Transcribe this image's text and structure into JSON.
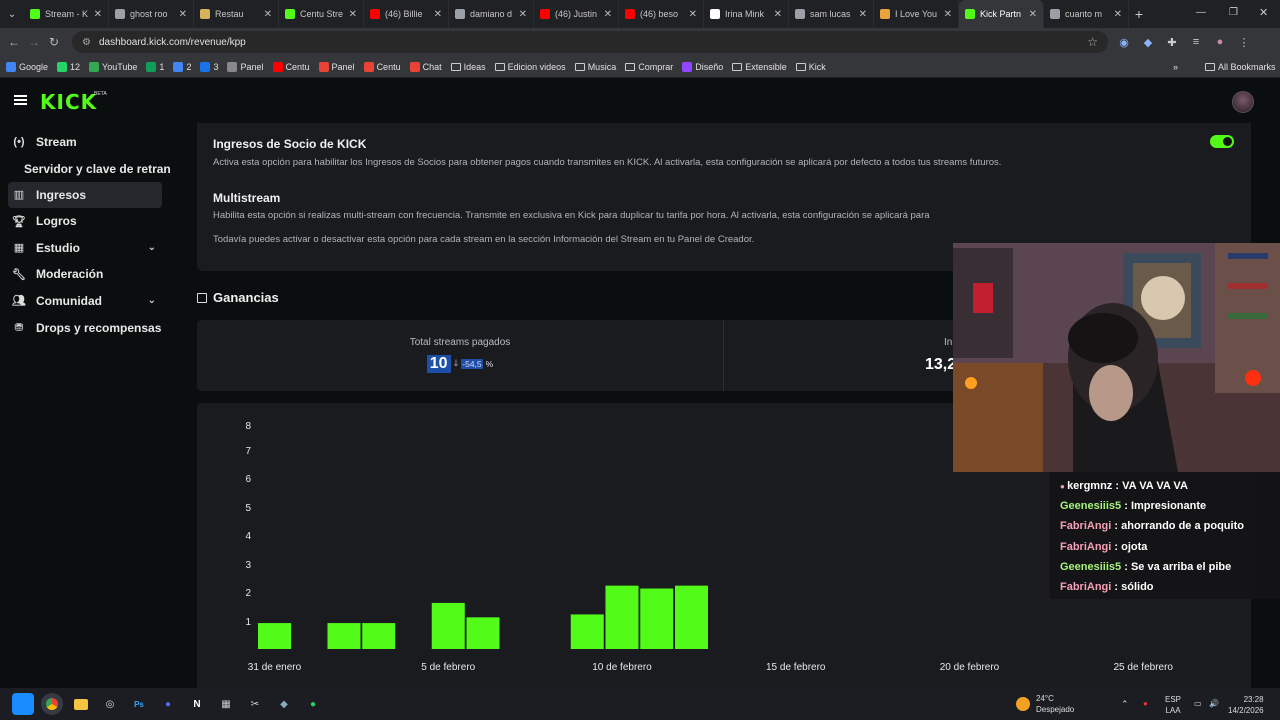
{
  "tabs": [
    {
      "title": "Stream - K",
      "color": "#53fc18"
    },
    {
      "title": "ghost roo",
      "color": "#9aa0a6"
    },
    {
      "title": "Restau",
      "color": "#d6b25a"
    },
    {
      "title": "Centu Stre",
      "color": "#53fc18"
    },
    {
      "title": "(46) Billie",
      "color": "#ff0000"
    },
    {
      "title": "damiano d",
      "color": "#9aa0a6"
    },
    {
      "title": "(46) Justin",
      "color": "#ff0000"
    },
    {
      "title": "(46) beso",
      "color": "#ff0000"
    },
    {
      "title": "Irina Mink",
      "color": "#ffffff"
    },
    {
      "title": "sam lucas",
      "color": "#9aa0a6"
    },
    {
      "title": "I Love You",
      "color": "#e8a33a"
    },
    {
      "title": "Kick Partn",
      "color": "#53fc18"
    },
    {
      "title": "cuanto m",
      "color": "#9aa0a6"
    }
  ],
  "url": "dashboard.kick.com/revenue/kpp",
  "bookmarks": [
    "Google",
    "12",
    "YouTube",
    "1",
    "2",
    "3",
    "Panel",
    "Centu",
    "Panel",
    "Centu",
    "Chat",
    "Ideas",
    "Edicion videos",
    "Musica",
    "Comprar",
    "Diseño",
    "Extensible",
    "Kick"
  ],
  "all_bookmarks": "All Bookmarks",
  "logo": "KICK",
  "logo_badge": "BETA",
  "sidebar": {
    "items": [
      {
        "label": "Stream",
        "icon": "broadcast-icon"
      },
      {
        "label": "Servidor y clave de retransm",
        "sub": true
      },
      {
        "label": "Ingresos",
        "icon": "bar-chart-icon",
        "active": true
      },
      {
        "label": "Logros",
        "icon": "trophy-icon"
      },
      {
        "label": "Estudio",
        "icon": "grid-icon",
        "chevron": true
      },
      {
        "label": "Moderación",
        "icon": "wrench-icon"
      },
      {
        "label": "Comunidad",
        "icon": "users-icon",
        "chevron": true
      },
      {
        "label": "Drops y recompensas",
        "icon": "gift-icon"
      }
    ]
  },
  "settings": {
    "kpp_title": "Ingresos de Socio de KICK",
    "kpp_desc": "Activa esta opción para habilitar los Ingresos de Socios para obtener pagos cuando transmites en KICK. Al activarla, esta configuración se aplicará por defecto a todos tus streams futuros.",
    "multi_title": "Multistream",
    "multi_desc": "Habilita esta opción si realizas multi-stream con frecuencia. Transmite en exclusiva en Kick para duplicar tu tarifa por hora. Al activarla, esta configuración se aplicará para",
    "info_desc": "Todavía puedes activar o desactivar esta opción para cada stream en la sección Información del Stream en tu Panel de Creador."
  },
  "ganancias": {
    "title": "Ganancias",
    "stat1_label": "Total streams pagados",
    "stat1_value": "10",
    "stat1_change": "-54,5",
    "stat1_unit": "%",
    "stat2_label": "In",
    "stat2_value": "13,2"
  },
  "chart_data": {
    "type": "bar",
    "y_ticks": [
      "1",
      "2",
      "3",
      "4",
      "5",
      "6",
      "7",
      "8"
    ],
    "x_labels": [
      "31 de enero",
      "5 de febrero",
      "10 de febrero",
      "15 de febrero",
      "20 de febrero",
      "25 de febrero"
    ],
    "ylim": [
      0,
      8
    ],
    "bars": [
      {
        "day": 0,
        "value": 0.9
      },
      {
        "day": 2,
        "value": 0.9
      },
      {
        "day": 3,
        "value": 0.9
      },
      {
        "day": 5,
        "value": 1.6
      },
      {
        "day": 6,
        "value": 1.1
      },
      {
        "day": 9,
        "value": 1.2
      },
      {
        "day": 10,
        "value": 2.2
      },
      {
        "day": 11,
        "value": 2.1
      },
      {
        "day": 12,
        "value": 2.2
      }
    ],
    "color": "#53fc18"
  },
  "chat": [
    {
      "user": "kergmnz",
      "text": "VA VA VA VA",
      "color": "#ffffff"
    },
    {
      "user": "Geenesiiis5",
      "text": "Impresionante",
      "color": "#a6f27a"
    },
    {
      "user": "FabriAngi",
      "text": "ahorrando de a poquito",
      "color": "#f5a0b4"
    },
    {
      "user": "FabriAngi",
      "text": "ojota",
      "color": "#f5a0b4"
    },
    {
      "user": "Geenesiiis5",
      "text": "Se va arriba el pibe",
      "color": "#a6f27a"
    },
    {
      "user": "FabriAngi",
      "text": "sólido",
      "color": "#f5a0b4"
    }
  ],
  "taskbar": {
    "weather_temp": "24°C",
    "weather_desc": "Despejado",
    "lang1": "ESP",
    "lang2": "LAA",
    "time": "23:28",
    "date": "14/2/2026"
  }
}
